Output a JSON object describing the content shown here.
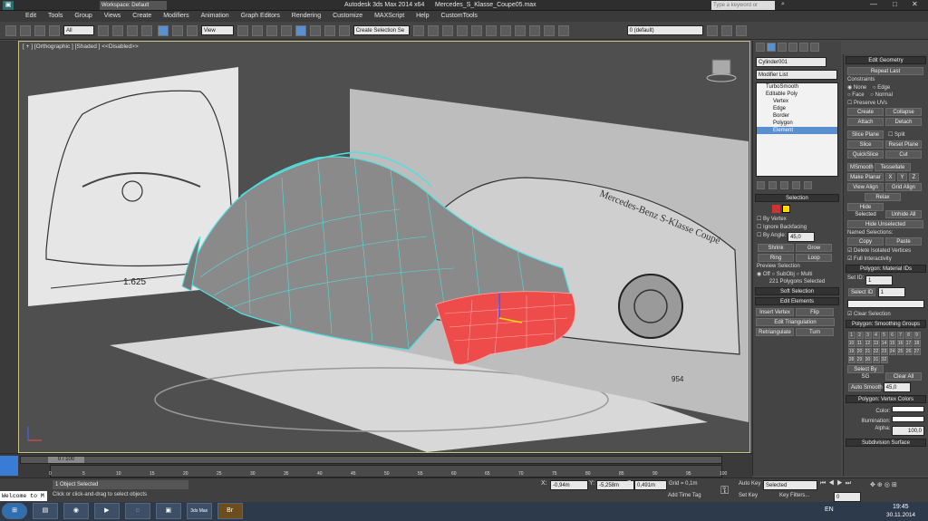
{
  "title": {
    "app": "Autodesk 3ds Max  2014 x64",
    "file": "Mercedes_S_Klasse_Coupe05.max",
    "workspace": "Workspace: Default",
    "search_placeholder": "Type a keyword or phrase"
  },
  "menu": [
    "Edit",
    "Tools",
    "Group",
    "Views",
    "Create",
    "Modifiers",
    "Animation",
    "Graph Editors",
    "Rendering",
    "Customize",
    "MAXScript",
    "Help",
    "CustomTools"
  ],
  "toolbar": {
    "filter": "All",
    "refcoord": "View",
    "selset": "Create Selection Se",
    "layer": "0 (default)"
  },
  "viewport": {
    "label": "[ + ] [Orthographic ] [Shaded ]  <<Disabled>>"
  },
  "command": {
    "object_name": "Cylinder001",
    "modifier_list": "Modifier List",
    "stack": [
      "TurboSmooth",
      "Editable Poly",
      "Vertex",
      "Edge",
      "Border",
      "Polygon",
      "Element"
    ],
    "selection_title": "Selection",
    "by_vertex": "By Vertex",
    "ignore_backfacing": "Ignore Backfacing",
    "by_angle": "By Angle:",
    "angle": "45,0",
    "shrink": "Shrink",
    "grow": "Grow",
    "ring": "Ring",
    "loop": "Loop",
    "preview_selection": "Preview Selection",
    "off": "Off",
    "subobj": "SubObj",
    "multi": "Multi",
    "selected_count": "221 Polygons Selected",
    "soft_selection": "Soft Selection",
    "edit_elements": "Edit Elements",
    "insert_vertex": "Insert Vertex",
    "flip": "Flip",
    "edit_triangulation": "Edit Triangulation",
    "retriangulate": "Retriangulate",
    "turn": "Turn"
  },
  "editgeom": {
    "title": "Edit Geometry",
    "repeat_last": "Repeat Last",
    "constraints": "Constraints",
    "none": "None",
    "edge": "Edge",
    "face": "Face",
    "normal": "Normal",
    "preserve_uvs": "Preserve UVs",
    "create": "Create",
    "collapse": "Collapse",
    "attach": "Attach",
    "detach": "Detach",
    "slice_plane": "Slice Plane",
    "split": "Split",
    "slice": "Slice",
    "reset_plane": "Reset Plane",
    "quickslice": "QuickSlice",
    "cut": "Cut",
    "msmooth": "MSmooth",
    "tessellate": "Tessellate",
    "make_planar": "Make Planar",
    "x": "X",
    "y": "Y",
    "z": "Z",
    "view_align": "View Align",
    "grid_align": "Grid Align",
    "relax": "Relax",
    "hide_selected": "Hide Selected",
    "unhide_all": "Unhide All",
    "hide_unselected": "Hide Unselected",
    "named_selections": "Named Selections:",
    "copy": "Copy",
    "paste": "Paste",
    "delete_isolated": "Delete Isolated Vertices",
    "full_interactivity": "Full Interactivity"
  },
  "matid": {
    "title": "Polygon: Material IDs",
    "set_id": "Set ID:",
    "select_id": "Select ID",
    "set_val": "1",
    "select_val": "1",
    "clear_selection": "Clear Selection"
  },
  "smooth": {
    "title": "Polygon: Smoothing Groups",
    "numbers": [
      "1",
      "2",
      "3",
      "4",
      "5",
      "6",
      "7",
      "8",
      "9",
      "10",
      "11",
      "12",
      "13",
      "14",
      "15",
      "16",
      "17",
      "18",
      "19",
      "20",
      "21",
      "22",
      "23",
      "24",
      "25",
      "26",
      "27",
      "28",
      "29",
      "30",
      "31",
      "32"
    ],
    "select_by_sg": "Select By SG",
    "clear_all": "Clear All",
    "auto_smooth": "Auto Smooth",
    "auto_val": "45,0"
  },
  "vcolors": {
    "title": "Polygon: Vertex Colors",
    "color": "Color:",
    "illumination": "Illumination:",
    "alpha": "Alpha:",
    "alpha_val": "100,0",
    "subdiv": "Subdivision Surface"
  },
  "timeline": {
    "frame": "0 / 100",
    "ticks": [
      "0",
      "5",
      "10",
      "15",
      "20",
      "25",
      "30",
      "35",
      "40",
      "45",
      "50",
      "55",
      "60",
      "65",
      "70",
      "75",
      "80",
      "85",
      "90",
      "95",
      "100"
    ]
  },
  "status": {
    "selected": "1 Object Selected",
    "prompt": "Click or click-and-drag to select objects",
    "listener": "Welcome to M",
    "x": "-0,94m",
    "y": "-5,258m",
    "z": "0,491m",
    "grid": "Grid = 0,1m",
    "add_time_tag": "Add Time Tag",
    "autokey": "Auto Key",
    "setkey": "Set Key",
    "selected_dd": "Selected",
    "key_filters": "Key Filters...",
    "frame_val": "0"
  },
  "taskbar": {
    "lang": "EN",
    "time": "19:45",
    "date": "30.11.2014",
    "apps": [
      "3ds Max",
      "Br"
    ]
  },
  "drawing": {
    "dim_front": "1.625",
    "side_text": "Mercedes-Benz S-Klasse Coupé",
    "dim_side": "954"
  }
}
